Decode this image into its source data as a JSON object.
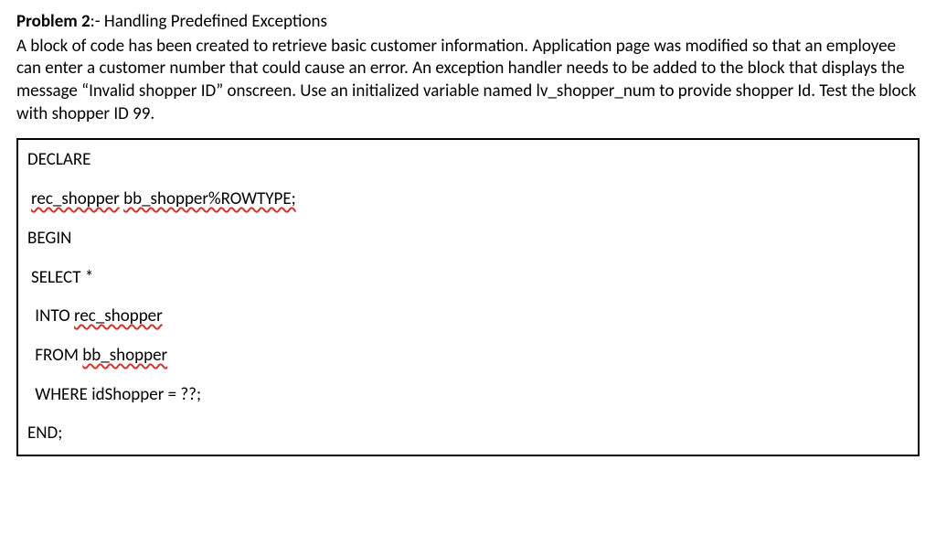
{
  "header": {
    "label": "Problem 2",
    "separator": ":-",
    "title": "Handling Predefined Exceptions"
  },
  "description": "A block of code has been created to retrieve basic customer information. Application page was modified so that an employee can enter a customer number that could cause an error. An exception handler needs to be added to the block that displays the message “Invalid shopper ID” onscreen. Use an initialized variable named lv_shopper_num to provide shopper Id. Test the block with shopper ID 99.",
  "code": {
    "line1": "DECLARE",
    "line2_a": "rec_shopper",
    "line2_b": "bb_shopper%ROWTYPE;",
    "line3": "BEGIN",
    "line4": "SELECT *",
    "line5_a": "INTO",
    "line5_b": "rec_shopper",
    "line6_a": "FROM",
    "line6_b": "bb_shopper",
    "line7": "WHERE idShopper = ??;",
    "line8": "END;"
  }
}
